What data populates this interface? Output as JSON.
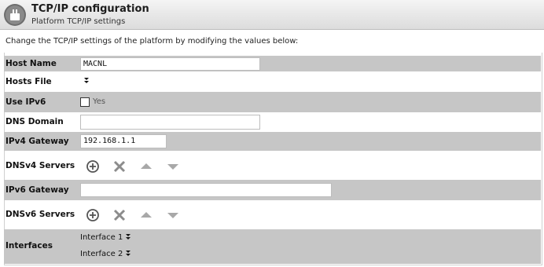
{
  "header": {
    "title": "TCP/IP configuration",
    "subtitle": "Platform TCP/IP settings"
  },
  "intro": "Change the TCP/IP settings of the platform by modifying the values below:",
  "fields": {
    "host_name": {
      "label": "Host Name",
      "value": "MACNL"
    },
    "hosts_file": {
      "label": "Hosts File"
    },
    "use_ipv6": {
      "label": "Use IPv6",
      "checkbox_label": "Yes",
      "checked": false
    },
    "dns_domain": {
      "label": "DNS Domain",
      "value": ""
    },
    "ipv4_gateway": {
      "label": "IPv4 Gateway",
      "value": "192.168.1.1"
    },
    "dnsv4_servers": {
      "label": "DNSv4 Servers"
    },
    "ipv6_gateway": {
      "label": "IPv6 Gateway",
      "value": ""
    },
    "dnsv6_servers": {
      "label": "DNSv6 Servers"
    },
    "interfaces": {
      "label": "Interfaces",
      "items": [
        "Interface 1",
        "Interface 2"
      ]
    }
  },
  "icons": {
    "expand": "double-chevron-down-icon",
    "add": "add-circle-icon",
    "remove": "remove-x-icon",
    "move_up": "move-up-icon",
    "move_down": "move-down-icon"
  },
  "colors": {
    "shaded_row": "#c6c6c6",
    "icon_gray": "#8c8c8c"
  }
}
